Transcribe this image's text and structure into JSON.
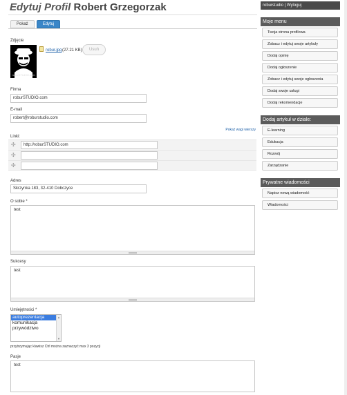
{
  "page": {
    "title_italic": "Edytuj Profil",
    "title_name": "Robert Grzegorzak"
  },
  "tabs": [
    {
      "label": "Pokaż",
      "active": false
    },
    {
      "label": "Edytuj",
      "active": true
    }
  ],
  "photo": {
    "label": "Zdjęcie",
    "caption": "roburSTUDIO.com",
    "file_name": "robur.jpg",
    "file_size": "(27.21 KB)",
    "remove_label": "Usuń"
  },
  "firma": {
    "label": "Firma",
    "value": "roburSTUDIO.com"
  },
  "email": {
    "label": "E-mail",
    "value": "robert@roburstudio.com"
  },
  "links": {
    "weights_toggle": "Pokaż wagi wierszy",
    "label": "Linki:",
    "rows": [
      {
        "value": "http://roburSTUDIO.com"
      },
      {
        "value": ""
      },
      {
        "value": ""
      }
    ]
  },
  "adres": {
    "label": "Adres",
    "value": "Skrzynka 183, 32-410 Dobczyce"
  },
  "about": {
    "label": "O sobie *",
    "value": "test"
  },
  "sukcesy": {
    "label": "Sukcesy",
    "value": "test"
  },
  "skills": {
    "label": "Umiejętności *",
    "options": [
      {
        "label": "autoprezentacja",
        "selected": true
      },
      {
        "label": "komunikacja",
        "selected": false
      },
      {
        "label": "przywództwo",
        "selected": false
      }
    ],
    "hint": "przytrzymując klawisz Ctrl można zaznaczyć max 3 pozycji"
  },
  "pasje": {
    "label": "Pasje",
    "value": "test"
  },
  "sidebar": {
    "user_line": "roburstudio | Wyloguj",
    "my_menu": {
      "title": "Moje menu",
      "items": [
        "Twoja strona profilowa",
        "Zobacz i edytuj swoje artykuły",
        "Dodaj opinię",
        "Dodaj ogłoszenie",
        "Zobacz i edytuj swoje ogłoszenia",
        "Dodaj swoje usługi",
        "Dodaj rekomendacje"
      ]
    },
    "add_article": {
      "title": "Dodaj artykuł w dziale:",
      "items": [
        "E-learning",
        "Edukacja",
        "Rozwój",
        "Zarządzanie"
      ]
    },
    "private_messages": {
      "title": "Prywatne wiadomości",
      "items": [
        "Napisz nową wiadomość",
        "Wiadomości"
      ]
    }
  },
  "colors": {
    "accent": "#3a86c8",
    "sidebar_header": "#5b5b5b",
    "link": "#1b5fa8"
  }
}
